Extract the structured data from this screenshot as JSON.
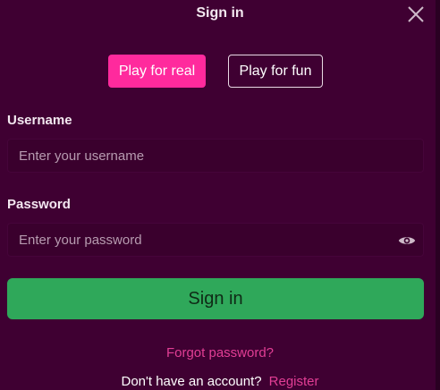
{
  "header": {
    "title": "Sign in",
    "close_icon": "close-icon"
  },
  "mode_toggle": {
    "real_label": "Play for real",
    "fun_label": "Play for fun",
    "selected": "Play for real"
  },
  "form": {
    "username_label": "Username",
    "username_placeholder": "Enter your username",
    "username_value": "",
    "password_label": "Password",
    "password_placeholder": "Enter your password",
    "password_value": "",
    "password_icon": "eye-icon"
  },
  "actions": {
    "signin_label": "Sign in",
    "forgot_label": "Forgot password?",
    "no_account_text": "Don't have an account?",
    "register_label": "Register"
  },
  "colors": {
    "background": "#3f0032",
    "accent_pink": "#ff2a9d",
    "link_pink": "#e23e95",
    "signin_green": "#2fa85a"
  }
}
